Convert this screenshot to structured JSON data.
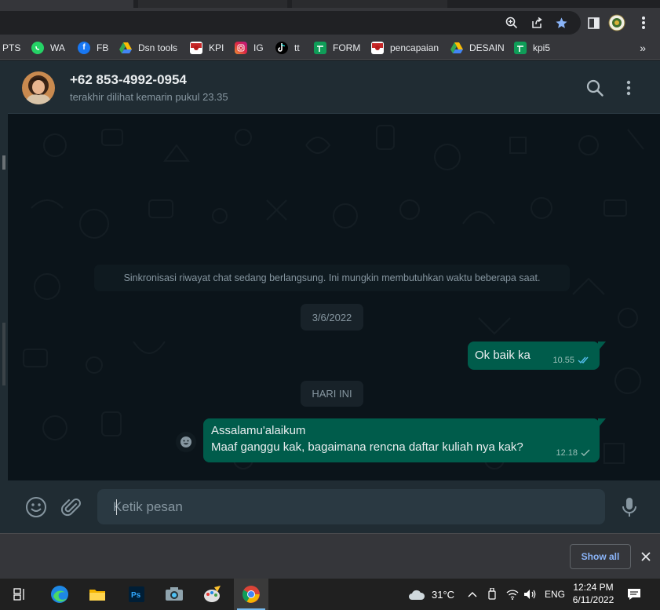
{
  "bookmarks": {
    "items": [
      {
        "label": "PTS",
        "icon": "bookmark-icon",
        "color": "#f5f5f5"
      },
      {
        "label": "WA",
        "icon": "whatsapp-icon",
        "color": "#25d366"
      },
      {
        "label": "FB",
        "icon": "facebook-icon",
        "color": "#1877f2"
      },
      {
        "label": "Dsn tools",
        "icon": "drive-icon",
        "color": "#34a853"
      },
      {
        "label": "KPI",
        "icon": "flag-icon",
        "color": "#c62828"
      },
      {
        "label": "IG",
        "icon": "instagram-icon",
        "color": "#d6249f"
      },
      {
        "label": "tt",
        "icon": "tiktok-icon",
        "color": "#000000"
      },
      {
        "label": "FORM",
        "icon": "sheets-icon",
        "color": "#0f9d58"
      },
      {
        "label": "pencapaian",
        "icon": "flag-icon",
        "color": "#c62828"
      },
      {
        "label": "DESAIN",
        "icon": "drive-icon",
        "color": "#34a853"
      },
      {
        "label": "kpi5",
        "icon": "sheets-icon",
        "color": "#0f9d58"
      }
    ],
    "more": "»"
  },
  "chat": {
    "contact_name": "+62 853-4992-0954",
    "last_seen": "terakhir dilihat kemarin pukul 23.35",
    "sync_notice": "Sinkronisasi riwayat chat sedang berlangsung. Ini mungkin membutuhkan waktu beberapa saat.",
    "date_1": "3/6/2022",
    "date_2": "HARI INI",
    "messages": [
      {
        "text": "Ok baik ka",
        "time": "10.55",
        "status": "read"
      },
      {
        "line1": "Assalamu'alaikum",
        "line2": "Maaf ganggu kak, bagaimana rencna daftar kuliah nya kak?",
        "time": "12.18",
        "status": "sent"
      }
    ],
    "input_placeholder": "Ketik pesan"
  },
  "download_bar": {
    "show_all": "Show all"
  },
  "taskbar": {
    "weather_temp": "31°C",
    "language": "ENG",
    "time": "12:24 PM",
    "date": "6/11/2022"
  },
  "colors": {
    "accent_green": "#005c4b",
    "read_ticks": "#53bdeb",
    "chat_bg": "#0b141a",
    "header_bg": "#202c33"
  }
}
